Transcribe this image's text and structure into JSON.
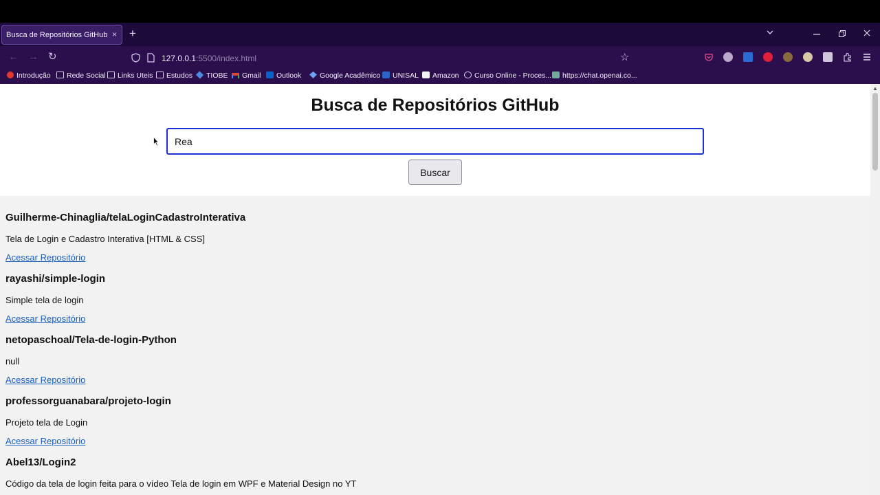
{
  "browser": {
    "tab": {
      "title": "Busca de Repositórios GitHub",
      "close_icon": "×"
    },
    "new_tab_icon": "+",
    "url": {
      "host": "127.0.0.1",
      "rest": ":5500/index.html"
    },
    "bookmarks": [
      {
        "label": "Introdução",
        "icon": "red-circle"
      },
      {
        "label": "Rede Social",
        "icon": "folder"
      },
      {
        "label": "Links Uteis",
        "icon": "folder"
      },
      {
        "label": "Estudos",
        "icon": "folder"
      },
      {
        "label": "TIOBE",
        "icon": "tiobe"
      },
      {
        "label": "Gmail",
        "icon": "gmail"
      },
      {
        "label": "Outlook",
        "icon": "outlook"
      },
      {
        "label": "Google Acadêmico",
        "icon": "scholar"
      },
      {
        "label": "UNISAL",
        "icon": "unisal"
      },
      {
        "label": "Amazon",
        "icon": "amazon"
      },
      {
        "label": "Curso Online - Proces...",
        "icon": "globe"
      },
      {
        "label": "https://chat.openai.co...",
        "icon": "openai"
      }
    ],
    "colors": {
      "frame": "#2b0f4d",
      "tabbar": "#1c0b3a",
      "active_tab": "#3a1f66"
    }
  },
  "page": {
    "heading": "Busca de Repositórios GitHub",
    "search": {
      "value": "Rea"
    },
    "search_button": "Buscar",
    "link_label": "Acessar Repositório",
    "repos": [
      {
        "name": "Guilherme-Chinaglia/telaLoginCadastroInterativa",
        "description": "Tela de Login e Cadastro Interativa [HTML & CSS]"
      },
      {
        "name": "rayashi/simple-login",
        "description": "Simple tela de login"
      },
      {
        "name": "netopaschoal/Tela-de-login-Python",
        "description": "null"
      },
      {
        "name": "professorguanabara/projeto-login",
        "description": "Projeto tela de Login"
      },
      {
        "name": "Abel13/Login2",
        "description": "Código da tela de login feita para o vídeo Tela de login em WPF e Material Design no YT"
      }
    ],
    "colors": {
      "link": "#1a5fbf",
      "input_focus_border": "#1b2fd6"
    }
  }
}
